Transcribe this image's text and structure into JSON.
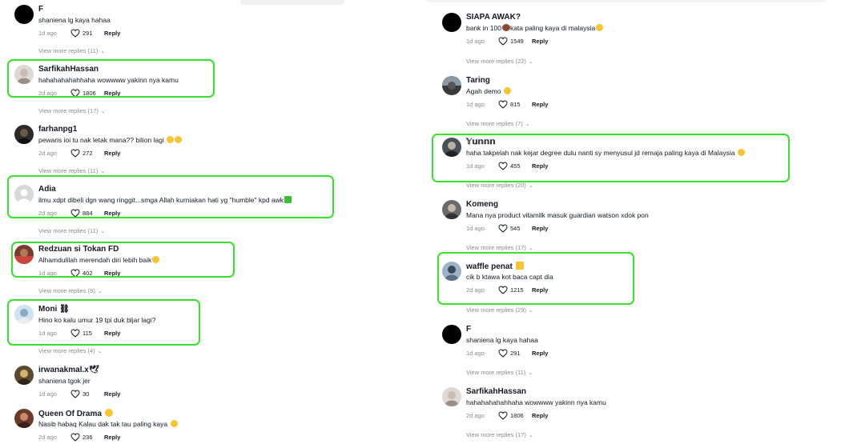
{
  "left_panel": {
    "comments": [
      {
        "username": "F",
        "text": "shaniena lg kaya hahaa",
        "date": "1d ago",
        "likes": "291",
        "reply": "Reply",
        "view_more": "View more replies (11)"
      },
      {
        "username": "SarfikahHassan",
        "text": "hahahahahahhaha wowwww yakinn nya kamu",
        "date": "2d ago",
        "likes": "1806",
        "reply": "Reply",
        "view_more": "View more replies (17)"
      },
      {
        "username": "farhanpg1",
        "text": "pewaris ioi tu nak letak mana?? bilion lagi",
        "date": "2d ago",
        "likes": "272",
        "reply": "Reply",
        "view_more": "View more replies (11)"
      },
      {
        "username": "Adia",
        "text": "ilmu xdpt dibeli dgn wang ringgit...smga Allah kurniakan hati yg \"humble\" kpd awk",
        "date": "2d ago",
        "likes": "884",
        "reply": "Reply",
        "view_more": "View more replies (11)"
      },
      {
        "username": "Redzuan si Tokan FD",
        "text": "Alhamdulilah merendah diri lebih baik",
        "date": "1d ago",
        "likes": "402",
        "reply": "Reply",
        "view_more": "View more replies (9)"
      },
      {
        "username": "Moni ⛓",
        "text": "Hino ko kalu umur 19 tpi duk bljar lagi?",
        "date": "1d ago",
        "likes": "115",
        "reply": "Reply",
        "view_more": "View more replies (4)"
      },
      {
        "username": "irwanakmal.x🕊",
        "text": "shaniena tgok jer",
        "date": "1d ago",
        "likes": "30",
        "reply": "Reply",
        "view_more": ""
      },
      {
        "username": "Queen Of Drama",
        "text": "Nasib habaq Kalau dak tak tau paling kaya",
        "date": "2d ago",
        "likes": "236",
        "reply": "Reply",
        "view_more": ""
      }
    ]
  },
  "right_panel": {
    "comments": [
      {
        "username": "SIAPA AWAK?",
        "text_before": "bank in 100",
        "text_after": "kata paling kaya di malaysia",
        "date": "1d ago",
        "likes": "1549",
        "reply": "Reply",
        "view_more": "View more replies (22)"
      },
      {
        "username": "Taring",
        "text": "Agah demo",
        "date": "1d ago",
        "likes": "815",
        "reply": "Reply",
        "view_more": "View more replies (7)"
      },
      {
        "username": "𝕐𝕦𝕟𝕟𝕟",
        "text": "haha takpelah nak kejar degree dulu nanti sy menyusul jd remaja paling kaya di Malaysia",
        "date": "1d ago",
        "likes": "455",
        "reply": "Reply",
        "view_more": "View more replies (20)"
      },
      {
        "username": "Komeng",
        "text": "Mana nya product vitamilk masuk guardian watson xdok pon",
        "date": "1d ago",
        "likes": "545",
        "reply": "Reply",
        "view_more": "View more replies (17)"
      },
      {
        "username": "waffle penat",
        "text": "cik b ktawa kot baca capt dia",
        "date": "2d ago",
        "likes": "1215",
        "reply": "Reply",
        "view_more": "View more replies (29)"
      },
      {
        "username": "F",
        "text": "shaniena lg kaya hahaa",
        "date": "1d ago",
        "likes": "291",
        "reply": "Reply",
        "view_more": "View more replies (11)"
      },
      {
        "username": "SarfikahHassan",
        "text": "hahahahahahhaha wowwww yakinn nya kamu",
        "date": "2d ago",
        "likes": "1806",
        "reply": "Reply",
        "view_more": "View more replies (17)"
      }
    ]
  },
  "colors": {
    "highlight": "#36e22b",
    "muted": "#8a8b91",
    "text": "#161823",
    "emoji": "#f7c531"
  },
  "icons": {
    "like": "heart-outline-icon",
    "chevron": "chevron-down-icon"
  }
}
